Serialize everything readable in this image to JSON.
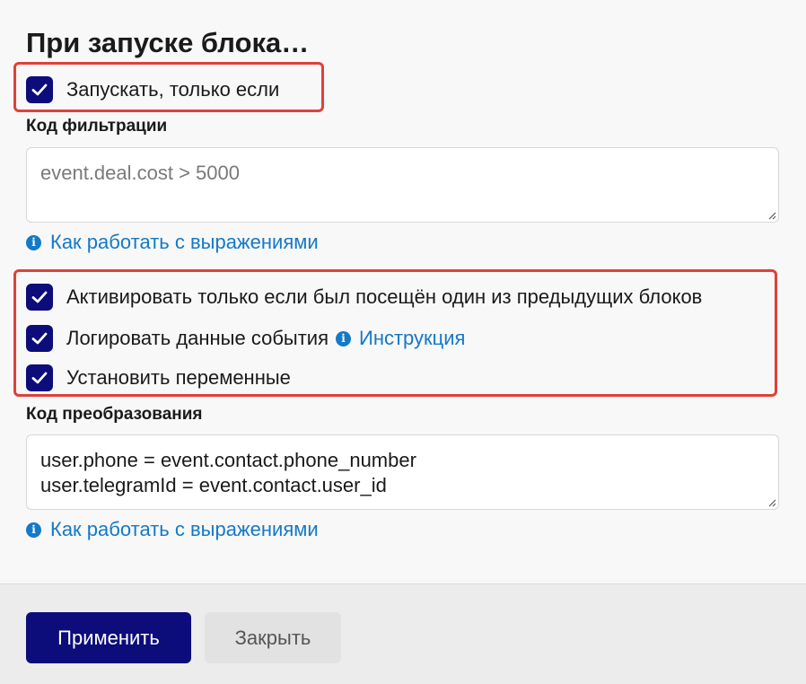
{
  "title": "При запуске блока…",
  "run_only_if": {
    "label": "Запускать, только если",
    "checked": true
  },
  "filter": {
    "label": "Код фильтрации",
    "placeholder": "event.deal.cost > 5000",
    "value": "",
    "help_link": "Как работать с выражениями"
  },
  "options": [
    {
      "label": "Активировать только если был посещён один из предыдущих блоков",
      "checked": true
    },
    {
      "label": "Логировать данные события",
      "checked": true,
      "link": "Инструкция"
    },
    {
      "label": "Установить переменные",
      "checked": true
    }
  ],
  "transform": {
    "label": "Код преобразования",
    "value": "user.phone = event.contact.phone_number\nuser.telegramId = event.contact.user_id",
    "help_link": "Как работать с выражениями"
  },
  "footer": {
    "apply": "Применить",
    "close": "Закрыть"
  },
  "colors": {
    "accent": "#0c0c7a",
    "link": "#1479c7",
    "highlight": "#e0403a"
  }
}
